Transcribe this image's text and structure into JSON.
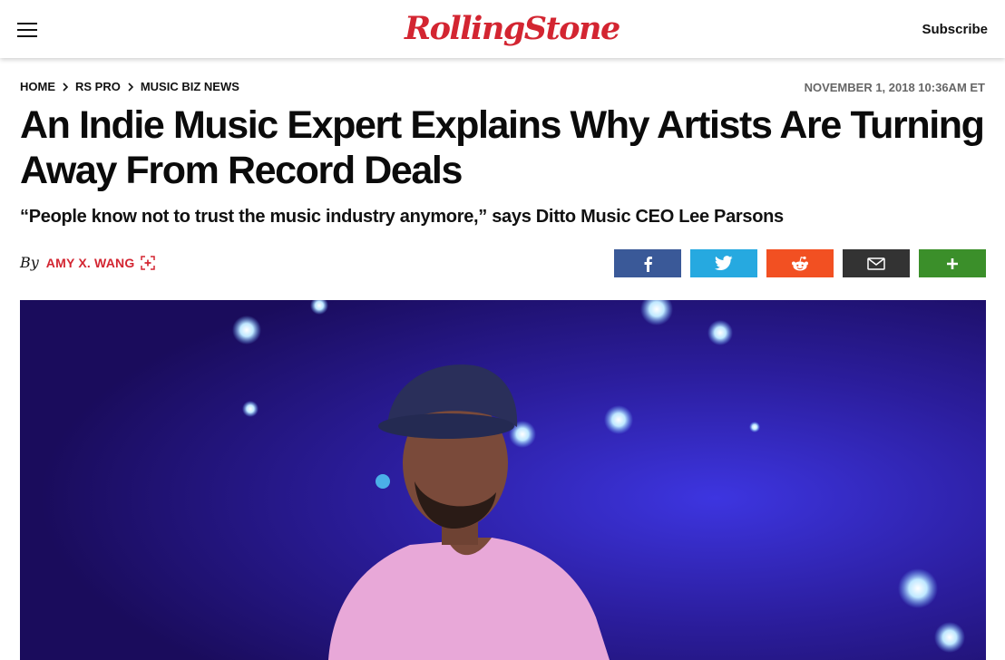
{
  "header": {
    "menu_icon": "hamburger-menu-icon",
    "logo_text": "RollingStone",
    "subscribe_label": "Subscribe"
  },
  "breadcrumb": [
    "HOME",
    "RS PRO",
    "MUSIC BIZ NEWS"
  ],
  "timestamp": "NOVEMBER 1, 2018 10:36AM ET",
  "headline": "An Indie Music Expert Explains Why Artists Are Turning Away From Record Deals",
  "dek": "“People know not to trust the music industry anymore,” says Ditto Music CEO Lee Parsons",
  "byline": {
    "by": "By",
    "author": "AMY X. WANG",
    "follow_icon": "follow-plus-icon"
  },
  "share": [
    {
      "name": "facebook",
      "icon": "facebook-icon",
      "color": "#3a5998"
    },
    {
      "name": "twitter",
      "icon": "twitter-icon",
      "color": "#26a9e0"
    },
    {
      "name": "reddit",
      "icon": "reddit-icon",
      "color": "#f25022"
    },
    {
      "name": "email",
      "icon": "email-icon",
      "color": "#333333"
    },
    {
      "name": "more",
      "icon": "plus-icon",
      "color": "#3b8f2a"
    }
  ],
  "hero_image": {
    "alt_subject": "performer in cap on stage",
    "colors": {
      "background": "#2a1c9a",
      "shirt": "#e7a6d6",
      "skin": "#7a4a3a"
    }
  }
}
